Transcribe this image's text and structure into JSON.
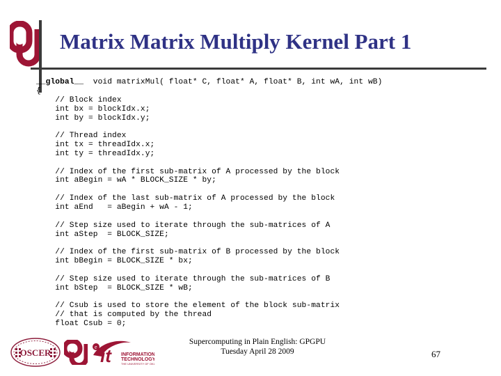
{
  "slide": {
    "title": "Matrix Matrix Multiply Kernel Part 1",
    "title_color": "#2f3285",
    "rule_color": "#3a3a3a",
    "background_color": "#ffffff"
  },
  "branding": {
    "header_logo": "ou-interlocking-logo",
    "header_logo_color": "#9d1535",
    "footer_logos": [
      {
        "name": "oscer-logo",
        "text": "OSCER",
        "color": "#8c1b3a"
      },
      {
        "name": "ou-logo",
        "text": "OU",
        "color": "#9d1535"
      },
      {
        "name": "ou-it-logo",
        "text": "it",
        "line1": "INFORMATION",
        "line2": "TECHNOLOGY",
        "line3": "THE UNIVERSITY OF OKLAHOMA",
        "color": "#9d1535"
      }
    ]
  },
  "code": {
    "language": "cuda-c",
    "lines": [
      "__global__  void matrixMul( float* C, float* A, float* B, int wA, int wB)",
      "{",
      "    // Block index",
      "    int bx = blockIdx.x;",
      "    int by = blockIdx.y;",
      "",
      "    // Thread index",
      "    int tx = threadIdx.x;",
      "    int ty = threadIdx.y;",
      "",
      "    // Index of the first sub-matrix of A processed by the block",
      "    int aBegin = wA * BLOCK_SIZE * by;",
      "",
      "    // Index of the last sub-matrix of A processed by the block",
      "    int aEnd   = aBegin + wA - 1;",
      "",
      "    // Step size used to iterate through the sub-matrices of A",
      "    int aStep  = BLOCK_SIZE;",
      "",
      "    // Index of the first sub-matrix of B processed by the block",
      "    int bBegin = BLOCK_SIZE * bx;",
      "",
      "    // Step size used to iterate through the sub-matrices of B",
      "    int bStep  = BLOCK_SIZE * wB;",
      "",
      "    // Csub is used to store the element of the block sub-matrix",
      "    // that is computed by the thread",
      "    float Csub = 0;"
    ],
    "bold_token": "__global__"
  },
  "footer": {
    "line1": "Supercomputing in Plain English: GPGPU",
    "line2": "Tuesday April 28 2009",
    "page_number": "67"
  }
}
